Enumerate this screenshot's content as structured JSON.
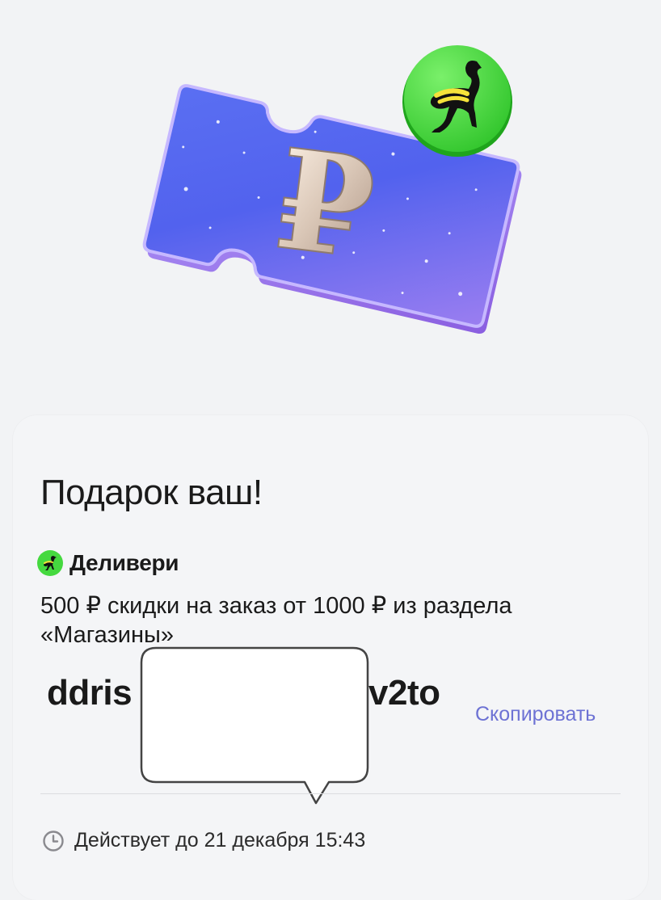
{
  "hero": {
    "coupon_symbol": "₽",
    "badge": "delivery-ostrich-logo"
  },
  "card": {
    "title": "Подарок ваш!",
    "brand": {
      "name": "Деливери",
      "icon": "delivery-ostrich-icon"
    },
    "description_line1": "500 ₽ скидки на заказ от 1000 ₽ из раздела",
    "description_line2": "«Магазины»",
    "promo_code": {
      "visible_start": "ddris",
      "visible_end": "v2to"
    },
    "copy_label": "Скопировать",
    "validity": "Действует до 21 декабря 15:43"
  },
  "colors": {
    "background": "#f2f3f5",
    "card": "#f4f5f7",
    "accent_link": "#6d72d4",
    "brand_green": "#45d93f",
    "coupon_purple": "#7b6ff0"
  }
}
